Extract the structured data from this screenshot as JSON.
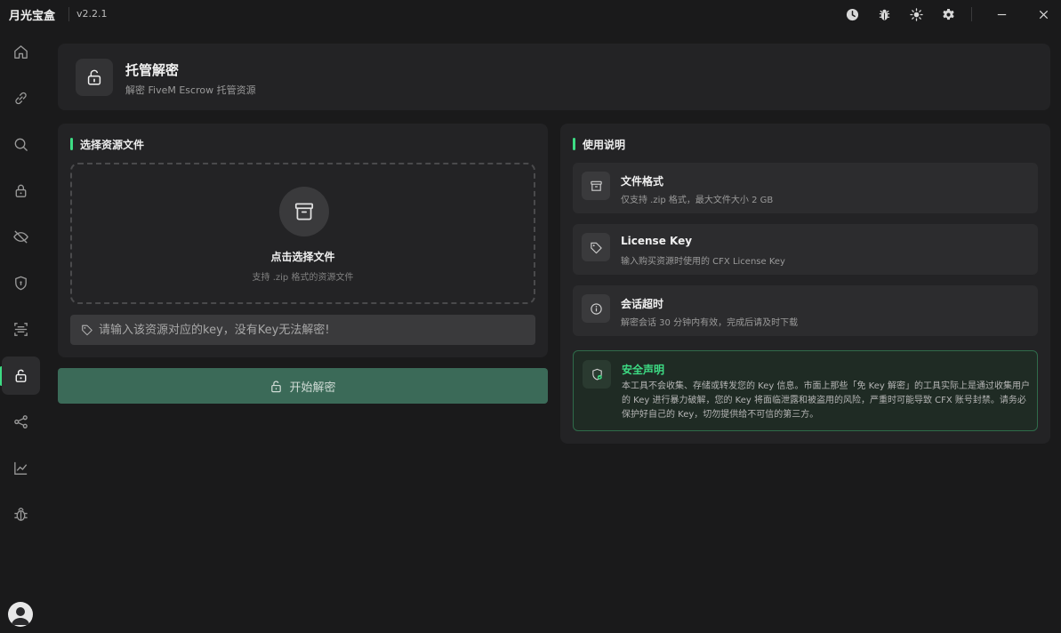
{
  "app": {
    "name": "月光宝盒",
    "version": "v2.2.1"
  },
  "titlebar": {
    "icons": [
      "clock-icon",
      "bug-icon",
      "sun-icon",
      "gear-icon",
      "minimize-icon",
      "close-icon"
    ],
    "minimize": "—",
    "close": "✕"
  },
  "sidebar": {
    "items": [
      "home-icon",
      "link-icon",
      "search-icon",
      "lock-icon",
      "eye-off-icon",
      "shield-icon",
      "scan-icon",
      "unlock-icon",
      "share-icon",
      "chart-icon",
      "bug-icon"
    ],
    "active_index": 7,
    "accent_color": "#3ddc84"
  },
  "header": {
    "title": "托管解密",
    "subtitle": "解密 FiveM Escrow 托管资源"
  },
  "left": {
    "section_title": "选择资源文件",
    "dropzone": {
      "title": "点击选择文件",
      "subtitle": "支持 .zip 格式的资源文件"
    },
    "key_input": {
      "placeholder": "请输入该资源对应的key，没有Key无法解密!",
      "value": ""
    },
    "start_button": "开始解密"
  },
  "right": {
    "section_title": "使用说明",
    "cards": [
      {
        "title": "文件格式",
        "desc": "仅支持 .zip 格式，最大文件大小 2 GB",
        "icon": "archive-icon"
      },
      {
        "title": "License Key",
        "desc": "输入购买资源时使用的 CFX License Key",
        "icon": "tag-icon"
      },
      {
        "title": "会话超时",
        "desc": "解密会话 30 分钟内有效，完成后请及时下载",
        "icon": "info-icon"
      }
    ],
    "security": {
      "title": "安全声明",
      "text": "本工具不会收集、存储或转发您的 Key 信息。市面上那些「免 Key 解密」的工具实际上是通过收集用户的 Key 进行暴力破解，您的 Key 将面临泄露和被盗用的风险，严重时可能导致 CFX 账号封禁。请务必保护好自己的 Key，切勿提供给不可信的第三方。",
      "icon": "shield-check-icon"
    }
  },
  "colors": {
    "background": "#1a1a1b",
    "panel": "#232325",
    "accent": "#3ddc84",
    "button": "#3b6a58"
  }
}
